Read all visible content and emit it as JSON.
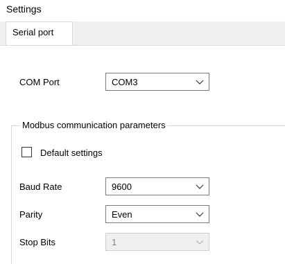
{
  "window": {
    "title": "Settings"
  },
  "tabs": [
    {
      "label": "Serial port"
    }
  ],
  "com_port": {
    "label": "COM Port",
    "value": "COM3"
  },
  "modbus_group": {
    "title": "Modbus communication parameters",
    "default_settings": {
      "label": "Default settings",
      "checked": false
    },
    "baud_rate": {
      "label": "Baud Rate",
      "value": "9600"
    },
    "parity": {
      "label": "Parity",
      "value": "Even"
    },
    "stop_bits": {
      "label": "Stop Bits",
      "value": "1",
      "enabled": false
    }
  },
  "icons": {
    "dropdown": "chevron-down-icon"
  }
}
